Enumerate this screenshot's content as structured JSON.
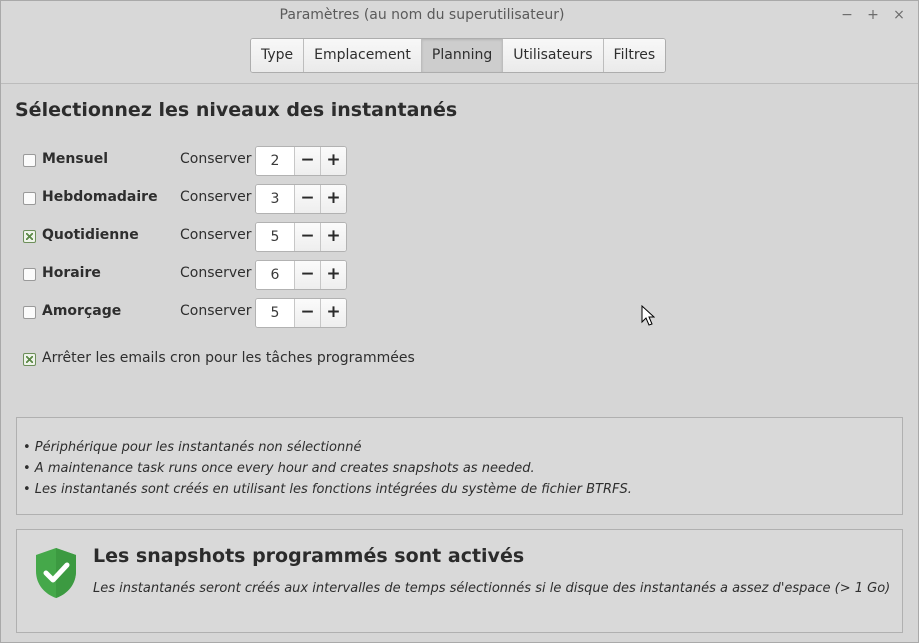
{
  "window": {
    "title": "Paramètres (au nom du superutilisateur)",
    "controls": {
      "minimize": "−",
      "maximize": "+",
      "close": "×"
    }
  },
  "tabs": [
    {
      "label": "Type",
      "active": false
    },
    {
      "label": "Emplacement",
      "active": false
    },
    {
      "label": "Planning",
      "active": true
    },
    {
      "label": "Utilisateurs",
      "active": false
    },
    {
      "label": "Filtres",
      "active": false
    }
  ],
  "section_title": "Sélectionnez les niveaux des instantanés",
  "keep_label": "Conserver",
  "levels": [
    {
      "label": "Mensuel",
      "checked": false,
      "keep": "2"
    },
    {
      "label": "Hebdomadaire",
      "checked": false,
      "keep": "3"
    },
    {
      "label": "Quotidienne",
      "checked": true,
      "keep": "5"
    },
    {
      "label": "Horaire",
      "checked": false,
      "keep": "6"
    },
    {
      "label": "Amorçage",
      "checked": false,
      "keep": "5"
    }
  ],
  "spin": {
    "minus": "−",
    "plus": "+"
  },
  "cron_option": {
    "label": "Arrêter les emails cron pour les tâches programmées",
    "checked": true
  },
  "info_lines": [
    "• Périphérique pour les instantanés non sélectionné",
    "• A maintenance task runs once every hour and creates snapshots as needed.",
    "• Les instantanés sont créés en utilisant les fonctions intégrées du système de fichier BTRFS."
  ],
  "status": {
    "icon": "shield-check-icon",
    "title": "Les snapshots programmés sont activés",
    "description": "Les instantanés seront créés aux intervalles de temps sélectionnés si le disque des instantanés a assez d'espace (> 1 Go)"
  },
  "colors": {
    "shield_green": "#4caf50",
    "check_green": "#5d8a48"
  }
}
